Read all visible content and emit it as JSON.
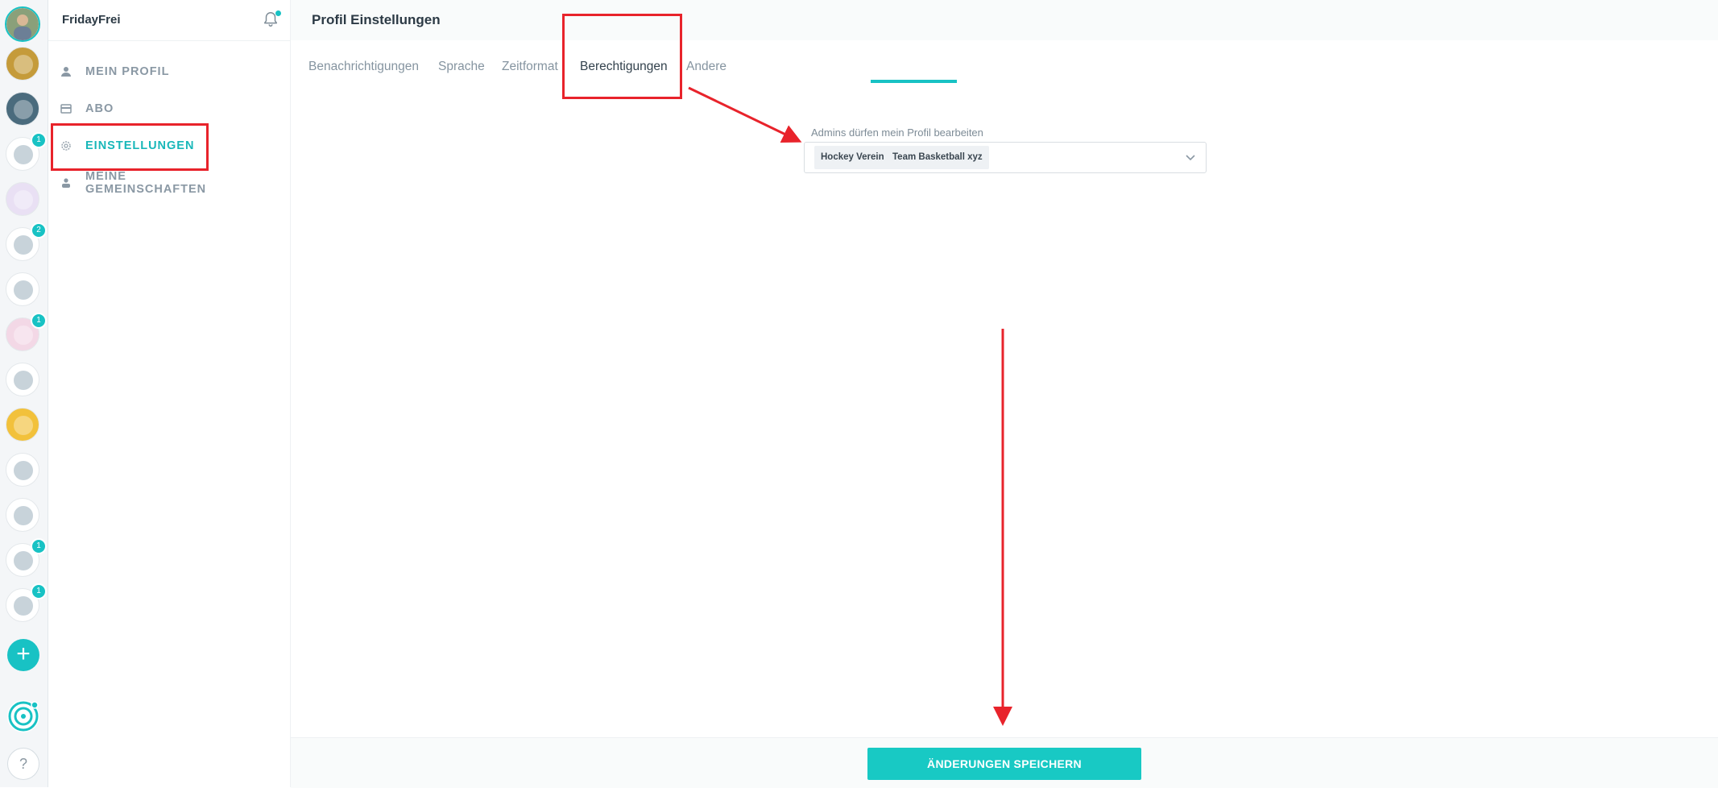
{
  "rail": {
    "communities": [
      {
        "name": "community-1",
        "bg": "#c59b3a",
        "badge": ""
      },
      {
        "name": "community-2",
        "bg": "#4a6b7d",
        "badge": ""
      },
      {
        "name": "community-3",
        "bg": "#ffffff",
        "badge": "1"
      },
      {
        "name": "community-4",
        "bg": "#e9e0f4",
        "badge": ""
      },
      {
        "name": "community-5",
        "bg": "#ffffff",
        "badge": "2"
      },
      {
        "name": "community-6",
        "bg": "#ffffff",
        "badge": ""
      },
      {
        "name": "community-7",
        "bg": "#f3d8e6",
        "badge": "1"
      },
      {
        "name": "community-8",
        "bg": "#ffffff",
        "badge": ""
      },
      {
        "name": "community-9",
        "bg": "#f2c13b",
        "badge": ""
      },
      {
        "name": "community-10",
        "bg": "#ffffff",
        "badge": ""
      },
      {
        "name": "community-11",
        "bg": "#ffffff",
        "badge": ""
      },
      {
        "name": "community-12",
        "bg": "#ffffff",
        "badge": "1"
      },
      {
        "name": "community-13",
        "bg": "#ffffff",
        "badge": "1"
      }
    ],
    "add_symbol": "+",
    "help_symbol": "?"
  },
  "sidebar": {
    "username": "FridayFrei",
    "nav": {
      "profile": "MEIN PROFIL",
      "abo": "ABO",
      "settings": "EINSTELLUNGEN",
      "communities": "MEINE GEMEINSCHAFTEN"
    }
  },
  "header": {
    "title": "Profil Einstellungen"
  },
  "tabs": {
    "notifications": "Benachrichtigungen",
    "language": "Sprache",
    "timeformat": "Zeitformat",
    "permissions": "Berechtigungen",
    "other": "Andere"
  },
  "permissions": {
    "label": "Admins dürfen mein Profil bearbeiten",
    "selected": [
      "Hockey Verein",
      "Team Basketball xyz"
    ]
  },
  "footer": {
    "save": "ÄNDERUNGEN SPEICHERN"
  },
  "colors": {
    "accent": "#18c2c4",
    "annotation": "#e8232b"
  }
}
